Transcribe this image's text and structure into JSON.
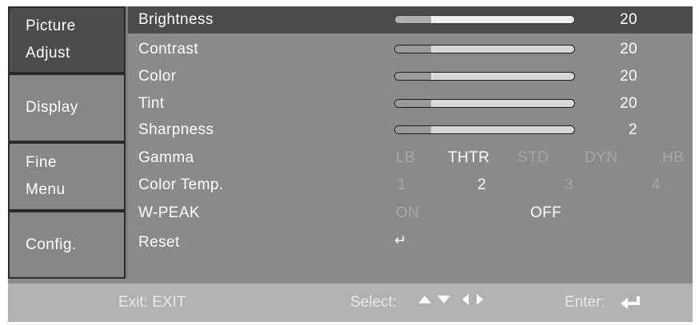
{
  "tabs": [
    {
      "line1": "Picture",
      "line2": "Adjust"
    },
    {
      "line1": "Display",
      "line2": ""
    },
    {
      "line1": "Fine",
      "line2": "Menu"
    },
    {
      "line1": "Config.",
      "line2": ""
    }
  ],
  "rows": {
    "brightness": {
      "label": "Brightness",
      "value": "20",
      "level": 0.2
    },
    "contrast": {
      "label": "Contrast",
      "value": "20",
      "level": 0.2
    },
    "color": {
      "label": "Color",
      "value": "20",
      "level": 0.2
    },
    "tint": {
      "label": "Tint",
      "value": "20",
      "level": 0.2
    },
    "sharpness": {
      "label": "Sharpness",
      "value": "2",
      "level": 0.2
    },
    "gamma": {
      "label": "Gamma",
      "options": [
        "LB",
        "THTR",
        "STD",
        "DYN",
        "HB"
      ],
      "selected": "THTR"
    },
    "color_temp": {
      "label": "Color Temp.",
      "options": [
        "1",
        "2",
        "3",
        "4"
      ],
      "selected": "2"
    },
    "w_peak": {
      "label": "W-PEAK",
      "options": [
        "ON",
        "OFF"
      ],
      "selected": "OFF"
    },
    "reset": {
      "label": "Reset",
      "icon": "enter-icon"
    }
  },
  "footer": {
    "exit": "Exit: EXIT",
    "select": "Select:",
    "enter": "Enter:",
    "icons": [
      "up-arrow-icon",
      "down-arrow-icon",
      "left-arrow-icon",
      "right-arrow-icon",
      "enter-icon"
    ]
  },
  "colors": {
    "panel": "#8a8a8a",
    "selected": "#4c4c4c",
    "footer": "#b2b2b2"
  }
}
